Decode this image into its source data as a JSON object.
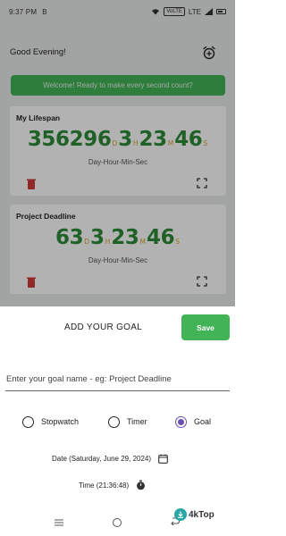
{
  "status_bar": {
    "time": "9:37 PM",
    "extra": "B",
    "network": "VoLTE",
    "signal_text": "LTE"
  },
  "header": {
    "greeting": "Good Evening!"
  },
  "banner": {
    "text": "Welcome! Ready to make every second count?"
  },
  "timers": [
    {
      "title": "My Lifespan",
      "days": "356296",
      "hours": "3",
      "minutes": "23",
      "seconds": "46",
      "unit_d": "D",
      "unit_h": "H",
      "unit_m": "M",
      "unit_s": "S",
      "caption": "Day-Hour-Min-Sec"
    },
    {
      "title": "Project Deadline",
      "days": "63",
      "hours": "3",
      "minutes": "23",
      "seconds": "46",
      "unit_d": "D",
      "unit_h": "H",
      "unit_m": "M",
      "unit_s": "S",
      "caption": "Day-Hour-Min-Sec"
    }
  ],
  "sheet": {
    "title": "ADD YOUR GOAL",
    "save_label": "Save",
    "goal_input": {
      "value": "",
      "placeholder": "Enter your goal name - eg: Project Deadline"
    },
    "modes": [
      {
        "label": "Stopwatch",
        "selected": false
      },
      {
        "label": "Timer",
        "selected": false
      },
      {
        "label": "Goal",
        "selected": true
      }
    ],
    "date_label": "Date (Saturday, June 29, 2024)",
    "time_label": "Time (21:36:48)"
  },
  "watermark": {
    "text": "4kTop"
  },
  "colors": {
    "accent_green": "#43b357",
    "digit_green": "#2e8b3a",
    "unit_gold": "#d8a32a",
    "radio_purple": "#6a4fb3"
  },
  "icons": [
    "alarm-add-icon",
    "trash-icon",
    "expand-icon",
    "calendar-icon",
    "stopwatch-icon",
    "nav-menu-icon",
    "nav-home-icon",
    "nav-back-icon"
  ]
}
